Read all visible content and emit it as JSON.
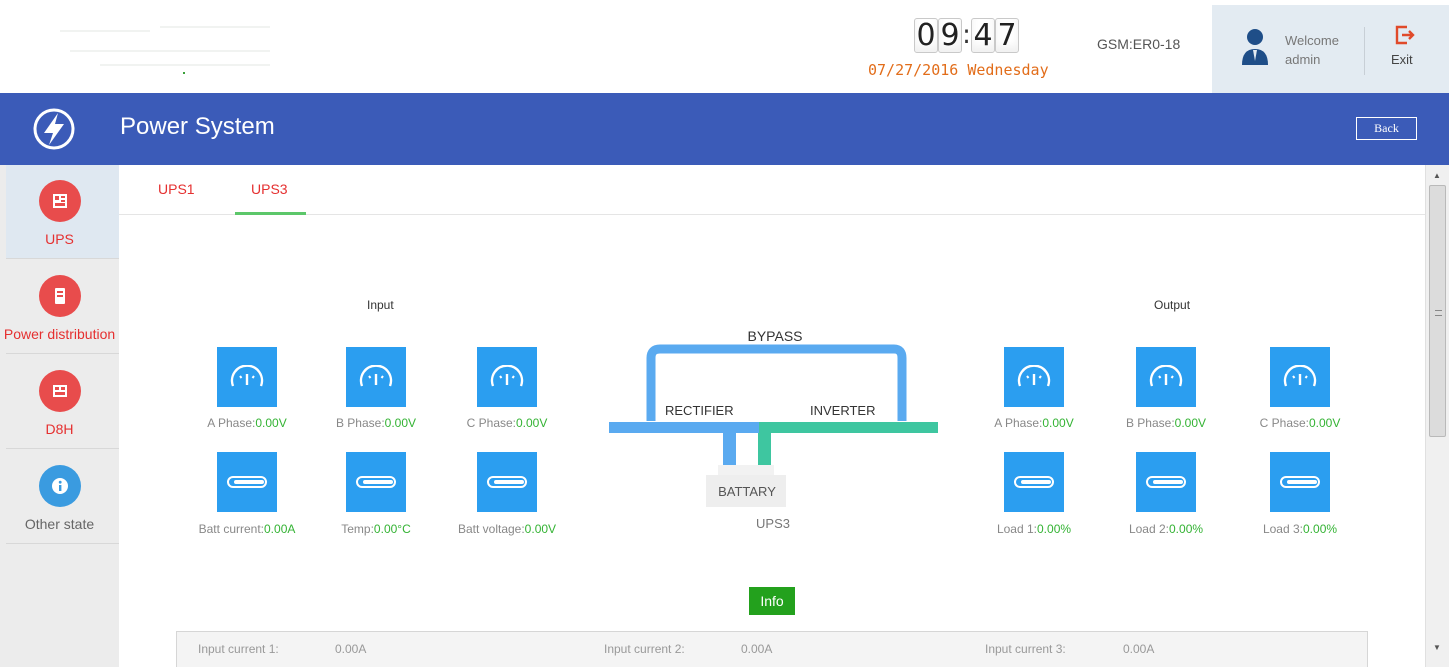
{
  "clock": {
    "d1": "0",
    "d2": "9",
    "sep": ":",
    "d3": "4",
    "d4": "7"
  },
  "date_line": "07/27/2016 Wednesday",
  "device_id": "GSM:ER0-18",
  "user": {
    "welcome": "Welcome",
    "name": "admin",
    "exit": "Exit"
  },
  "header": {
    "title": "Power System",
    "back": "Back"
  },
  "sidebar": {
    "items": [
      {
        "label": "UPS",
        "color": "#e84c4c",
        "active": true
      },
      {
        "label": "Power distribution",
        "color": "#e84c4c",
        "active": false
      },
      {
        "label": "D8H",
        "color": "#e84c4c",
        "active": false
      },
      {
        "label": "Other state",
        "color": "#3a9be0",
        "active": false
      }
    ]
  },
  "tabs": [
    {
      "label": "UPS1"
    },
    {
      "label": "UPS3",
      "active": true
    }
  ],
  "input": {
    "label": "Input",
    "meters": [
      {
        "name": "A Phase:",
        "value": "0.00V"
      },
      {
        "name": "B Phase:",
        "value": "0.00V"
      },
      {
        "name": "C Phase:",
        "value": "0.00V"
      },
      {
        "name": "Batt current:",
        "value": "0.00A"
      },
      {
        "name": "Temp:",
        "value": "0.00°C"
      },
      {
        "name": "Batt voltage:",
        "value": "0.00V"
      }
    ]
  },
  "output": {
    "label": "Output",
    "meters": [
      {
        "name": "A Phase:",
        "value": "0.00V"
      },
      {
        "name": "B Phase:",
        "value": "0.00V"
      },
      {
        "name": "C Phase:",
        "value": "0.00V"
      },
      {
        "name": "Load 1:",
        "value": "0.00%"
      },
      {
        "name": "Load 2:",
        "value": "0.00%"
      },
      {
        "name": "Load 3:",
        "value": "0.00%"
      }
    ]
  },
  "diagram": {
    "bypass": "BYPASS",
    "rectifier": "RECTIFIER",
    "inverter": "INVERTER",
    "battery": "BATTARY",
    "unit": "UPS3",
    "colors": {
      "blue": "#5aaaf0",
      "green": "#3ec6a0"
    }
  },
  "info_button": "Info",
  "currents": [
    {
      "label": "Input current 1:",
      "value": "0.00A"
    },
    {
      "label": "Input current 2:",
      "value": "0.00A"
    },
    {
      "label": "Input current 3:",
      "value": "0.00A"
    }
  ]
}
